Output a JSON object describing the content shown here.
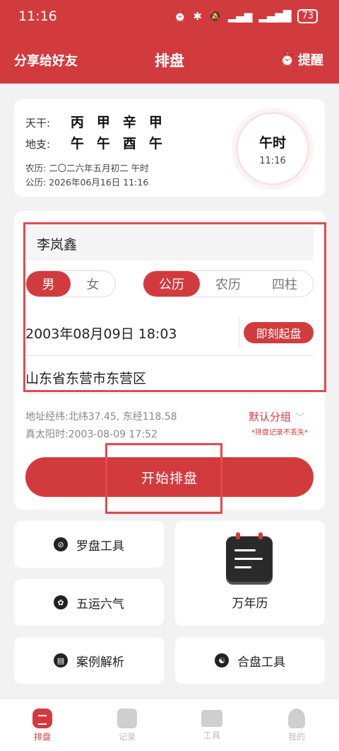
{
  "status": {
    "time": "11:16",
    "battery": "73"
  },
  "header": {
    "share": "分享给好友",
    "title": "排盘",
    "remind": "提醒"
  },
  "ganzhi": {
    "tiangan_label": "天干:",
    "tiangan": [
      "丙",
      "甲",
      "辛",
      "甲"
    ],
    "dizhi_label": "地支:",
    "dizhi": [
      "午",
      "午",
      "酉",
      "午"
    ],
    "lunar": "农历: 二〇二六年五月初二 午时",
    "solar": "公历: 2026年06月16日 11:16",
    "clock_hour": "午时",
    "clock_time": "11:16"
  },
  "form": {
    "name": "李岚鑫",
    "gender": [
      "男",
      "女"
    ],
    "calendar": [
      "公历",
      "农历",
      "四柱"
    ],
    "datetime": "2003年08月09日 18:03",
    "instant_button": "即刻起盘",
    "place": "山东省东营市东营区",
    "coords": "地址经纬:北纬37.45, 东经118.58",
    "true_solar": "真太阳时:2003-08-09 17:52",
    "group": "默认分组",
    "group_note": "*排盘记录不丢失*",
    "start_button": "开始排盘"
  },
  "tools": {
    "compass": "罗盘工具",
    "wuyun": "五运六气",
    "calendar": "万年历",
    "case": "案例解析",
    "hepan": "合盘工具"
  },
  "tabs": [
    "排盘",
    "记录",
    "工具",
    "我的"
  ]
}
